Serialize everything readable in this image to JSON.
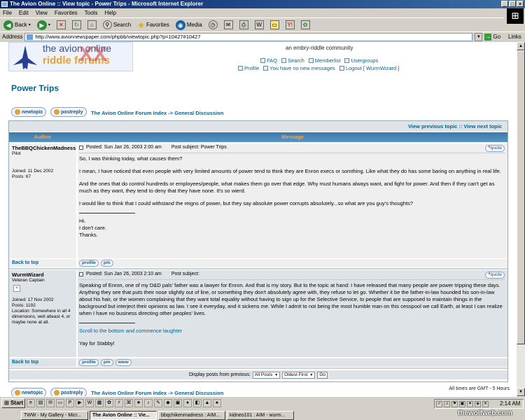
{
  "window": {
    "title": "The Avion Online :: View topic - Power Trips - Microsoft Internet Explorer"
  },
  "menu": [
    "File",
    "Edit",
    "View",
    "Favorites",
    "Tools",
    "Help"
  ],
  "toolbar": {
    "back": "Back",
    "search": "Search",
    "favorites": "Favorites",
    "media": "Media"
  },
  "address": {
    "label": "Address",
    "url": "http://www.avionnewspaper.com/phpbb/viewtopic.php?p=10427#10427",
    "go": "Go",
    "links": "Links"
  },
  "header": {
    "logo_line1": "the avion online",
    "logo_line2": "riddle forums",
    "site_desc": "an embry-riddle community",
    "nav1": [
      "FAQ",
      "Search",
      "Memberlist",
      "Usergroups"
    ],
    "nav2": [
      "Profile",
      "You have no new messages",
      "Logout [ WurmWizard ]"
    ]
  },
  "topic_title": "Power Trips",
  "buttons": {
    "newtopic": "newtopic",
    "postreply": "postreply"
  },
  "breadcrumb": {
    "index": "The Avion Online Forum Index",
    "sep": "->",
    "forum": "General Discussion"
  },
  "table": {
    "prev": "View previous topic",
    "sep": "::",
    "next": "View next topic",
    "col_author": "Author",
    "col_message": "Message"
  },
  "posts": [
    {
      "author": "TheBBQChickenMadness",
      "rank": "Pilot",
      "joined": "Joined: 11 Dec 2002",
      "posts": "Posts: 67",
      "posted": "Posted: Sun Jan 26, 2003 2:00 am",
      "subject": "Post subject: Power Trips",
      "quote": "quote",
      "body": [
        "So, I was thinking today, what causes them?",
        "I mean, I have noticed that even people with very limited amounts of power tend to think they are Enron execs or somthing. Like what they do has some baring on anything in real life.",
        "And the ones that do control hundreds or employees/people, what makes them go over that edge. Why must humans always want, and fight for power. And then if they can't get as much as they want, they tend to deny that they have none. It's so wierd.",
        "I would like to think that I could withstand the reigns of power, but they say absolute power corrupts absolutely...so what are you guy's thoughts?"
      ],
      "sig": [
        "Hi.",
        "I don't care.",
        "Thanks."
      ],
      "back_to_top": "Back to top",
      "btn_profile": "profile",
      "btn_pm": "pm"
    },
    {
      "author": "WurmWizard",
      "rank": "Veteran Captain",
      "joined": "Joined: 17 Nov 2002",
      "posts": "Posts: 1192",
      "location": "Location: Somewhere in all 4 dimensions, well atleast 4, or maybe none at all.",
      "posted": "Posted: Sun Jan 26, 2003 2:10 am",
      "subject": "Post subject:",
      "quote": "quote",
      "body": [
        "Speaking of Enron, one of my D&D pals' father was a lawyer for Enron. And that is my story. But to the topic at hand: I have released that many people are power tripping these days. Anything they see that puts their nose slightly out of line, or something they don't absolutely agree with, they refuse to let go. Whether it be the father-in-law hounded his son-in-law about his hair, or the women complaining that they want total equality without having to sign up for the Selective Service, to people that are supposed to maintain things in the background but interject their opinions as law. I see it everyday, and it sickens me. While I admit to not being the most humble man on this cesspool we call Earth, at least I can realize when I have no business directing other peoples' lives."
      ],
      "sig_link": "Scroll to the bottom and commence laughter",
      "sig_text": "Yay for Stabby!",
      "back_to_top": "Back to top",
      "btn_profile": "profile",
      "btn_pm": "pm",
      "btn_www": "www"
    }
  ],
  "display": {
    "label": "Display posts from previous:",
    "sel1": "All Posts",
    "sel2": "Oldest First",
    "go": "Go"
  },
  "times": "All times are GMT - 5 Hours",
  "taskbar": {
    "start": "Start",
    "tasks": [
      "TWW - My Gallery - Micr...",
      "The Avion Online :: Vie...",
      "bbqchikenmadness : AIM...",
      "kidneo101 : AIM - wurm..."
    ],
    "clock": "2:14 AM"
  },
  "watermark": "thewolfweb.com"
}
